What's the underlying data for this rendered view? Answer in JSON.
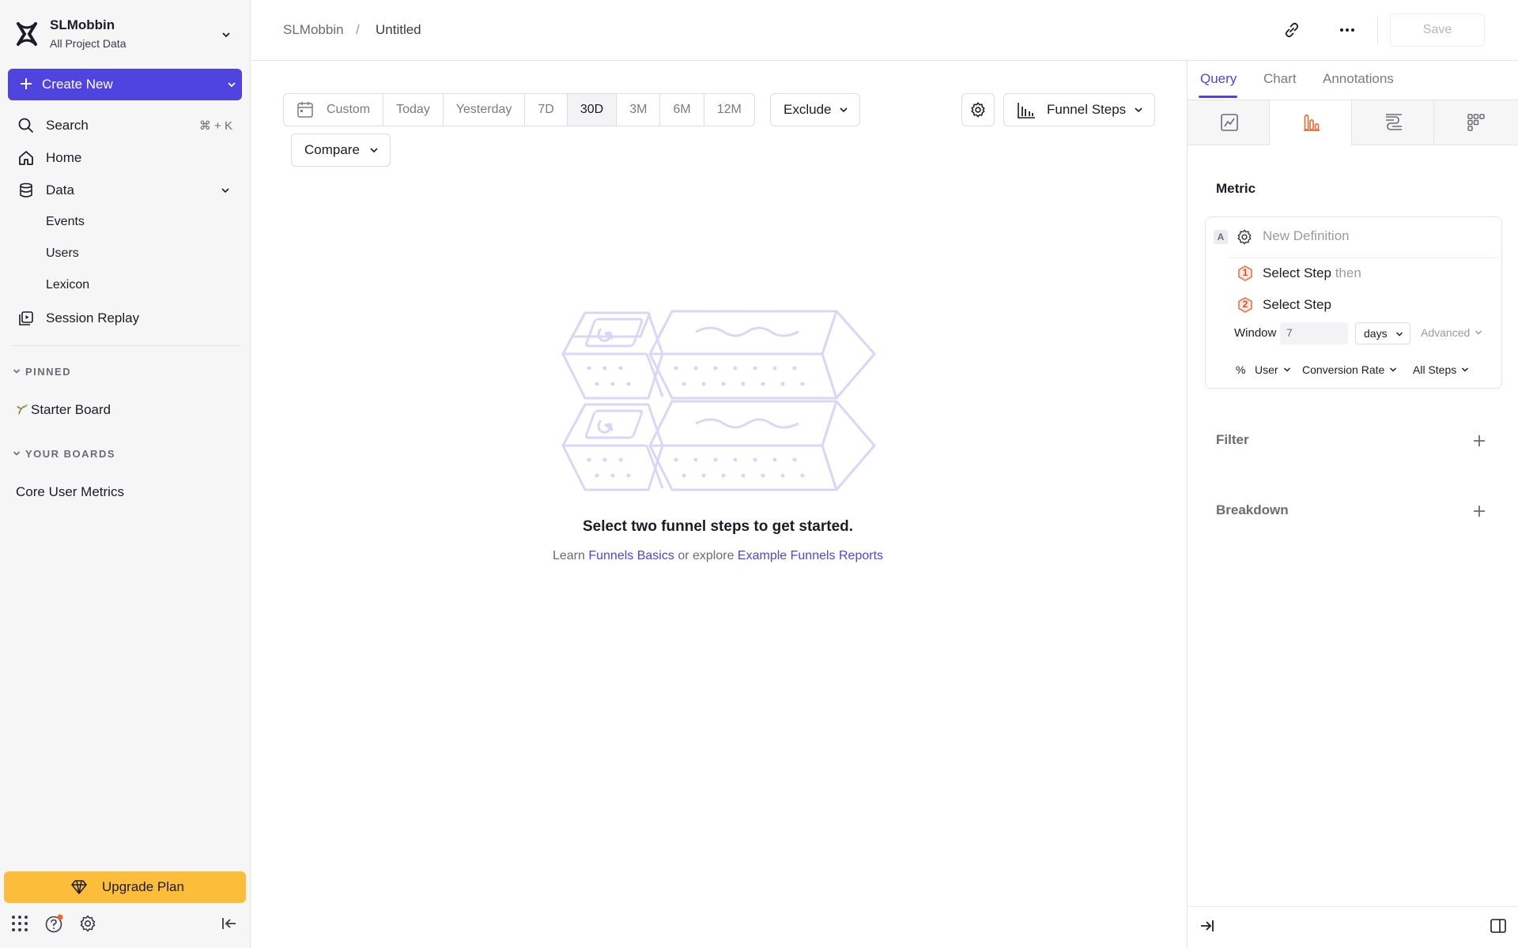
{
  "project": {
    "name": "SLMobbin",
    "subtitle": "All Project Data"
  },
  "sidebar": {
    "create_label": "Create New",
    "search": {
      "label": "Search",
      "shortcut": "⌘ + K"
    },
    "home": "Home",
    "data": "Data",
    "data_items": [
      "Events",
      "Users",
      "Lexicon"
    ],
    "session_replay": "Session Replay",
    "pinned_header": "PINNED",
    "pinned_items": [
      "Starter Board"
    ],
    "boards_header": "YOUR BOARDS",
    "board_items": [
      "Core User Metrics"
    ],
    "upgrade_label": "Upgrade Plan"
  },
  "breadcrumb": {
    "project": "SLMobbin",
    "separator": "/",
    "page": "Untitled"
  },
  "toolbar": {
    "save_label": "Save"
  },
  "date_range": {
    "options": [
      "Custom",
      "Today",
      "Yesterday",
      "7D",
      "30D",
      "3M",
      "6M",
      "12M"
    ],
    "selected": "30D"
  },
  "controls": {
    "exclude": "Exclude",
    "compare": "Compare",
    "chart_type": "Funnel Steps"
  },
  "empty_state": {
    "title": "Select two funnel steps to get started.",
    "learn": "Learn",
    "link1": "Funnels Basics",
    "mid": "or explore",
    "link2": "Example Funnels Reports"
  },
  "panel": {
    "tabs": [
      "Query",
      "Chart",
      "Annotations"
    ],
    "active_tab": "Query",
    "view_icons": [
      "insights-icon",
      "funnels-icon",
      "flows-icon",
      "retention-icon"
    ],
    "metric_header": "Metric",
    "metric": {
      "letter": "A",
      "definition_placeholder": "New Definition",
      "steps": [
        {
          "num": "1",
          "label": "Select Step",
          "suffix": "then"
        },
        {
          "num": "2",
          "label": "Select Step",
          "suffix": ""
        }
      ],
      "window_label": "Window",
      "window_value": "7",
      "window_unit": "days",
      "advanced": "Advanced",
      "options": {
        "percent": "%",
        "user": "User",
        "measure": "Conversion Rate",
        "steps": "All Steps"
      }
    },
    "filter_header": "Filter",
    "breakdown_header": "Breakdown"
  },
  "colors": {
    "accent": "#4f44e0",
    "upgrade": "#fbbd3a",
    "step": "#e8703d",
    "illustration": "#d9d6f7"
  }
}
